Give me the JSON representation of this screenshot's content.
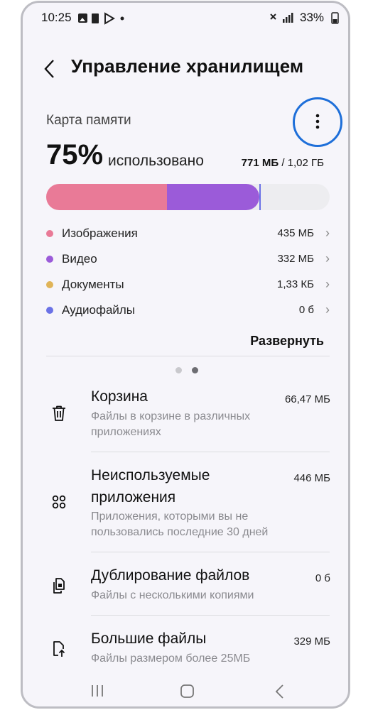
{
  "status_bar": {
    "time": "10:25",
    "battery": "33%"
  },
  "header": {
    "back_label": "‹",
    "title": "Управление хранилищем"
  },
  "storage": {
    "label": "Карта памяти",
    "percent": "75%",
    "used_label": "использовано",
    "used_size": "771 МБ",
    "separator": " / ",
    "total_size": "1,02 ГБ",
    "used_fraction": 0.75
  },
  "categories": [
    {
      "label": "Изображения",
      "value": "435 МБ",
      "color": "#e97a97"
    },
    {
      "label": "Видео",
      "value": "332 МБ",
      "color": "#9b5bd9"
    },
    {
      "label": "Документы",
      "value": "1,33 КБ",
      "color": "#e0b458"
    },
    {
      "label": "Аудиофайлы",
      "value": "0 б",
      "color": "#6b72e6"
    }
  ],
  "expand_label": "Развернуть",
  "items": [
    {
      "title": "Корзина",
      "desc": "Файлы в корзине в различных приложениях",
      "value": "66,47 МБ",
      "icon": "trash-icon"
    },
    {
      "title": "Неиспользуемые приложения",
      "desc": "Приложения, которыми вы не пользовались последние 30 дней",
      "value": "446 МБ",
      "icon": "apps-icon"
    },
    {
      "title": "Дублирование файлов",
      "desc": "Файлы с несколькими копиями",
      "value": "0 б",
      "icon": "duplicate-files-icon"
    },
    {
      "title": "Большие файлы",
      "desc": "Файлы размером более 25МБ",
      "value": "329 МБ",
      "icon": "large-file-icon"
    }
  ],
  "colors": {
    "accent_ring": "#1e6fd9",
    "background": "#f6f5fa"
  },
  "nav": {
    "recents": "recents-icon",
    "home": "home-icon",
    "back": "back-icon"
  }
}
